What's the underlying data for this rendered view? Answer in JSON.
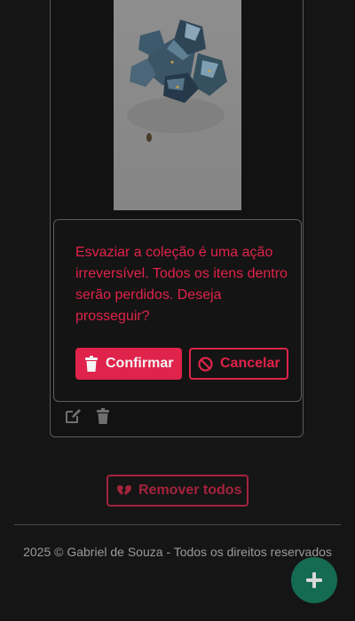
{
  "colors": {
    "background": "#151515",
    "danger": "#e0234a",
    "danger_dim": "#a4233d",
    "fab": "#156b52",
    "icon": "#6f6f6f"
  },
  "card": {
    "image": "dice-photo",
    "actions": [
      {
        "icon": "edit-icon"
      },
      {
        "icon": "trash-icon"
      }
    ]
  },
  "modal": {
    "message": "Esvaziar a coleção é uma ação irreversível. Todos os itens dentro serão perdidos. Deseja prosseguir?",
    "confirm": {
      "label": "Confirmar",
      "icon": "trash-icon"
    },
    "cancel": {
      "label": "Cancelar",
      "icon": "ban-icon"
    }
  },
  "remove_all": {
    "label": "Remover todos",
    "icon": "broken-heart-icon"
  },
  "footer": {
    "text": "2025 © Gabriel de Souza - Todos os direitos reservados"
  },
  "fab": {
    "icon": "plus-icon"
  }
}
